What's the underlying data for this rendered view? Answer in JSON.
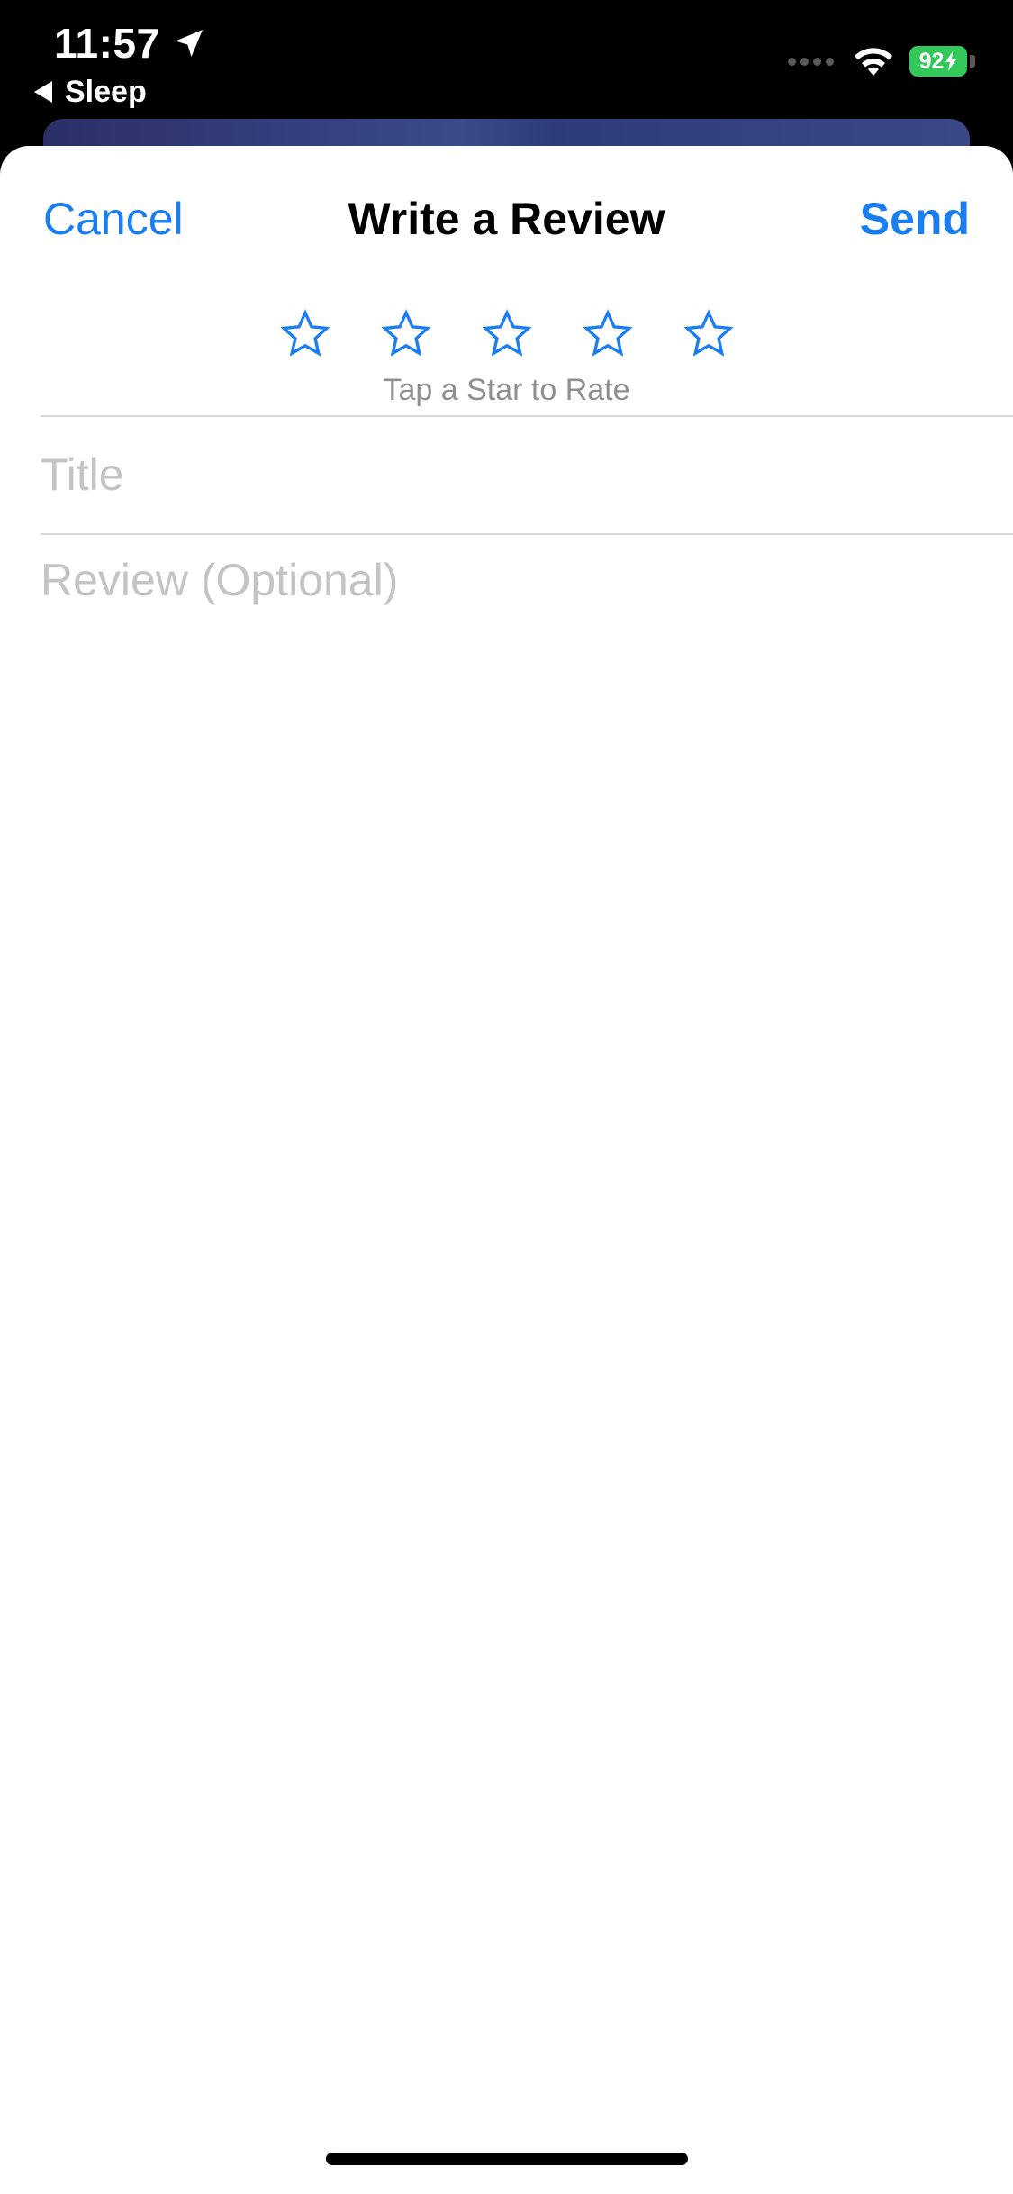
{
  "status_bar": {
    "time": "11:57",
    "back_app": "Sleep",
    "battery_level": "92",
    "battery_color": "#34c759"
  },
  "nav": {
    "cancel_label": "Cancel",
    "title": "Write a Review",
    "send_label": "Send",
    "accent_color": "#1a7ef0"
  },
  "rating": {
    "star_count": 5,
    "selected": 0,
    "hint": "Tap a Star to Rate"
  },
  "form": {
    "title_placeholder": "Title",
    "title_value": "",
    "review_placeholder": "Review (Optional)",
    "review_value": ""
  },
  "icons": {
    "location": "location-arrow-icon",
    "back": "back-triangle-icon",
    "wifi": "wifi-icon",
    "signal": "cellular-signal-icon",
    "charging": "bolt-icon",
    "star": "star-outline-icon"
  }
}
